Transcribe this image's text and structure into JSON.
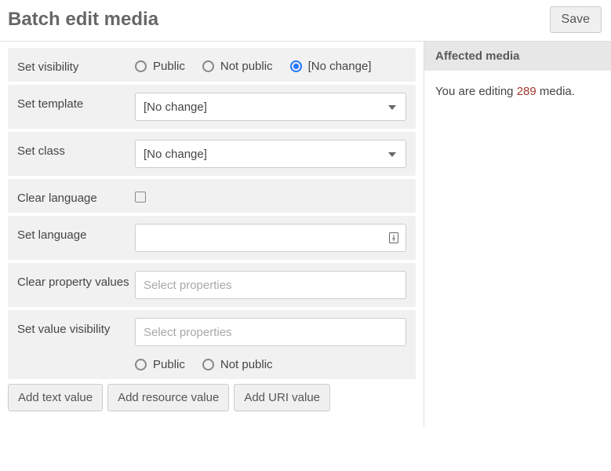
{
  "header": {
    "title": "Batch edit media",
    "save": "Save"
  },
  "rows": {
    "visibility": {
      "label": "Set visibility",
      "opts": {
        "public": "Public",
        "notpublic": "Not public",
        "nochange": "[No change]"
      },
      "selected": "nochange"
    },
    "template": {
      "label": "Set template",
      "value": "[No change]"
    },
    "class_": {
      "label": "Set class",
      "value": "[No change]"
    },
    "clearlang": {
      "label": "Clear language"
    },
    "setlang": {
      "label": "Set language",
      "value": ""
    },
    "clearprop": {
      "label": "Clear property values",
      "placeholder": "Select properties"
    },
    "valuevis": {
      "label": "Set value visibility",
      "placeholder": "Select properties",
      "opts": {
        "public": "Public",
        "notpublic": "Not public"
      }
    }
  },
  "buttons": {
    "text": "Add text value",
    "resource": "Add resource value",
    "uri": "Add URI value"
  },
  "side": {
    "heading": "Affected media",
    "pre": "You are editing ",
    "count": "289",
    "post": " media."
  }
}
